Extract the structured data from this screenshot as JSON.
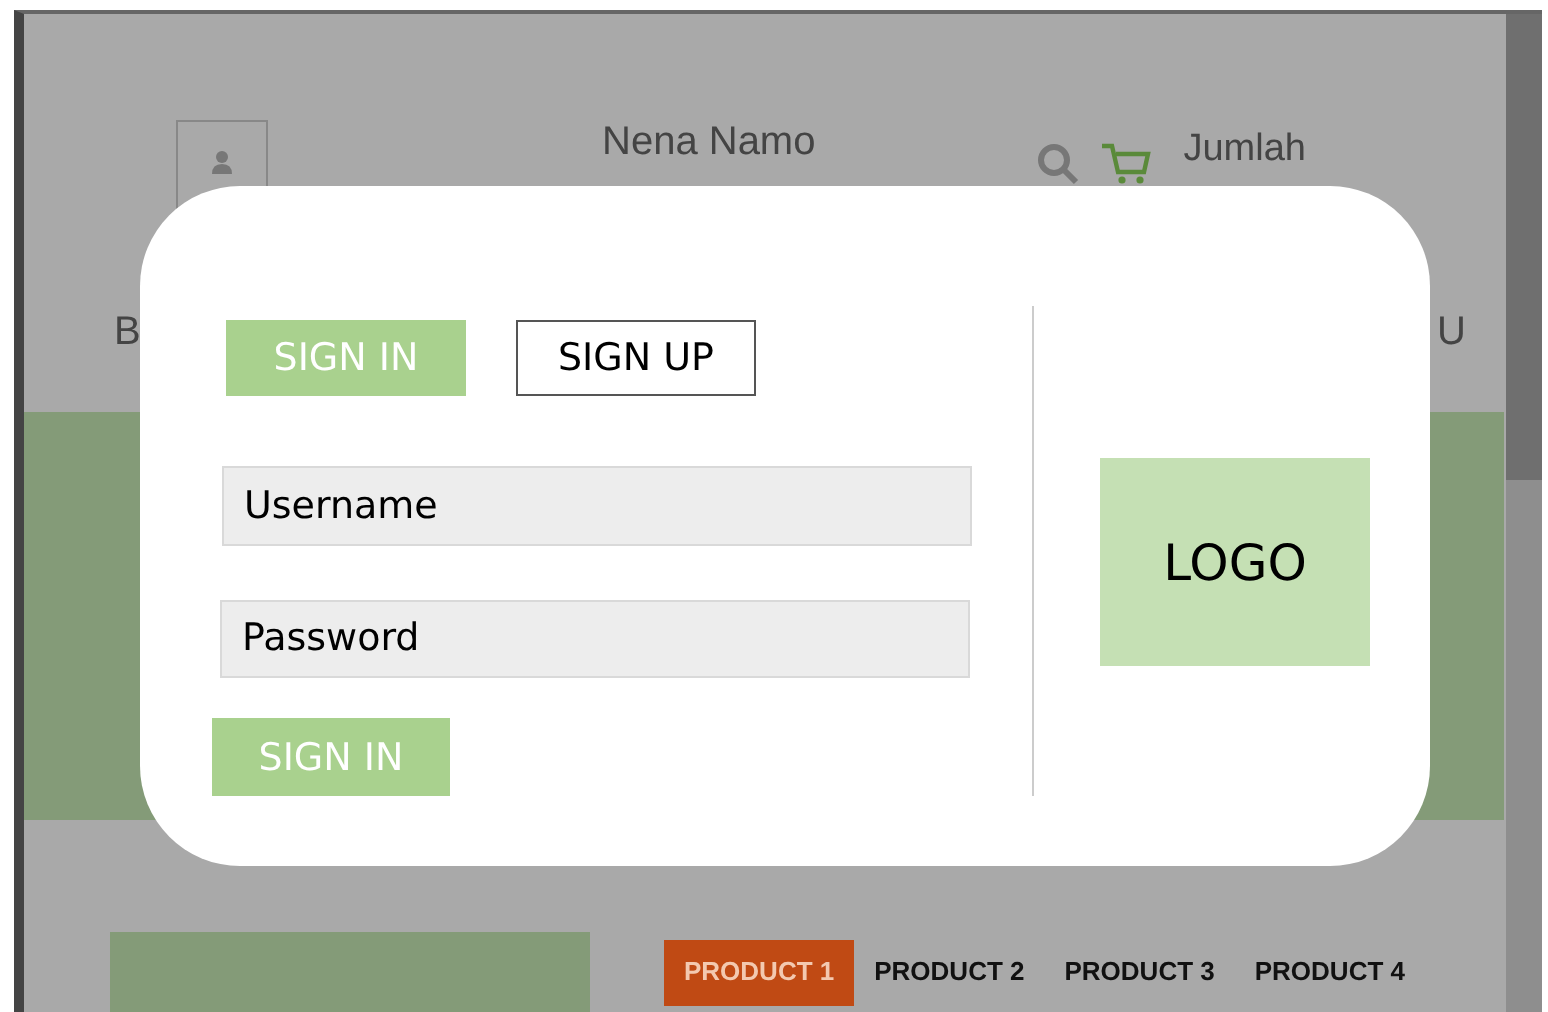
{
  "header": {
    "name": "Nena Namo",
    "cart_label": "Jumlah"
  },
  "nav": [
    "B",
    "U"
  ],
  "products": [
    {
      "label": "PRODUCT 1",
      "selected": true
    },
    {
      "label": "PRODUCT 2",
      "selected": false
    },
    {
      "label": "PRODUCT 3",
      "selected": false
    },
    {
      "label": "PRODUCT 4",
      "selected": false
    }
  ],
  "modal": {
    "tabs": [
      {
        "label": "SIGN IN",
        "selected": true
      },
      {
        "label": "SIGN UP",
        "selected": false
      }
    ],
    "fields": [
      {
        "placeholder": "Username"
      },
      {
        "placeholder": "Password"
      }
    ],
    "submit": "SIGN IN",
    "logo": "LOGO"
  }
}
